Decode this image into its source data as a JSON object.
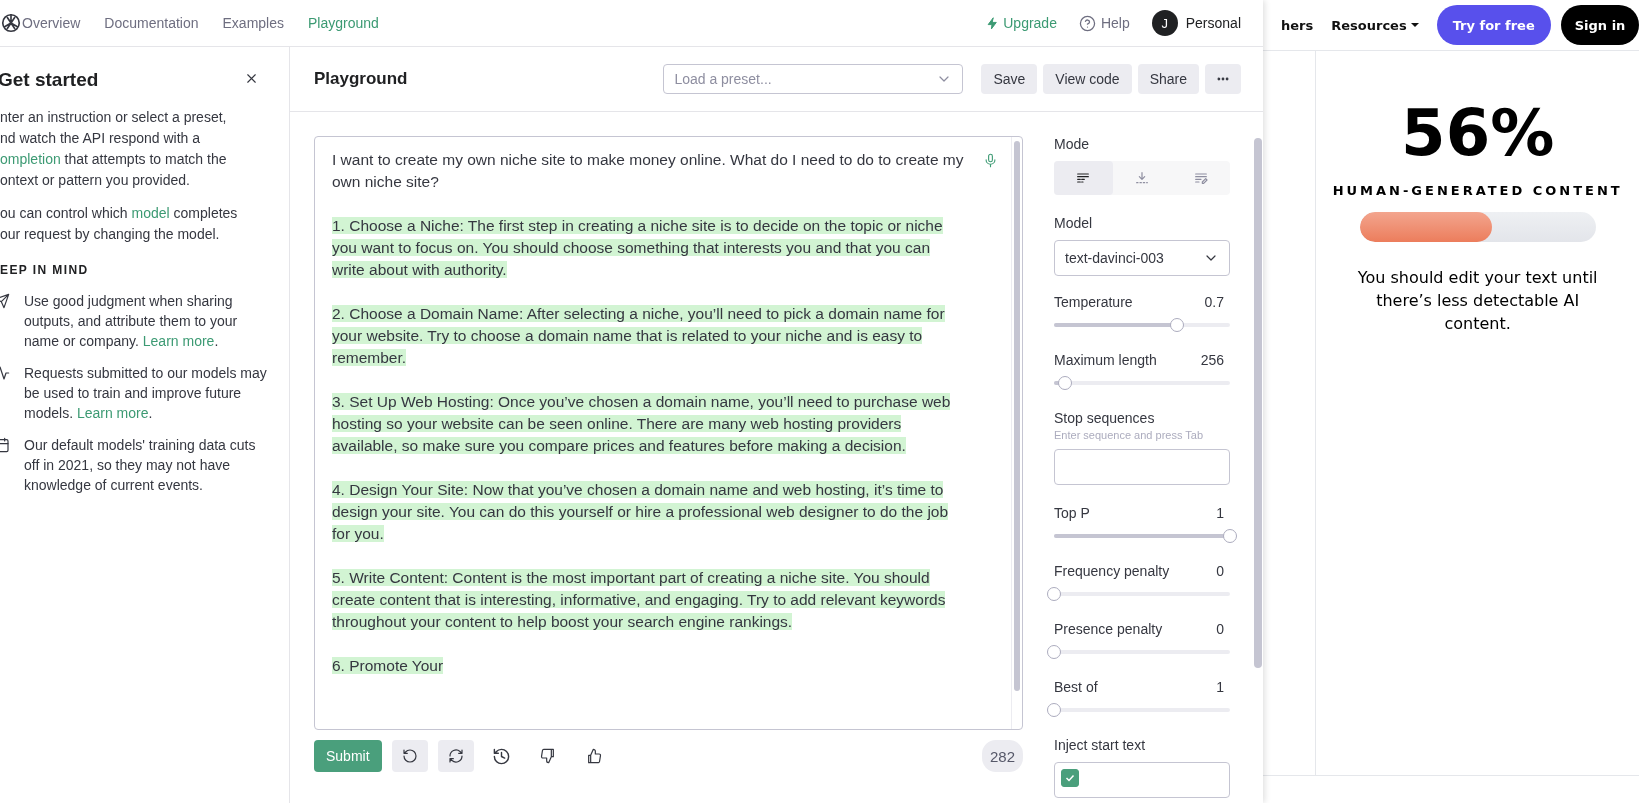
{
  "nav": {
    "tabs": [
      {
        "label": "Overview",
        "selected": false
      },
      {
        "label": "Documentation",
        "selected": false
      },
      {
        "label": "Examples",
        "selected": false
      },
      {
        "label": "Playground",
        "selected": true
      }
    ],
    "upgrade": "Upgrade",
    "help": "Help",
    "avatar": "J",
    "account": "Personal"
  },
  "sidebar": {
    "title": "Get started",
    "paragraphs": [
      [
        [
          {
            "text": "nter an instruction or select a preset,",
            "kind": "text"
          }
        ],
        [
          {
            "text": "nd watch the API respond with a",
            "kind": "text"
          }
        ],
        [
          {
            "text": "ompletion",
            "kind": "link"
          },
          {
            "text": " that attempts to match the",
            "kind": "text"
          }
        ],
        [
          {
            "text": "ontext or pattern you provided.",
            "kind": "text"
          }
        ]
      ],
      [
        [
          {
            "text": "ou can control which ",
            "kind": "text"
          },
          {
            "text": "model",
            "kind": "link"
          },
          {
            "text": " completes",
            "kind": "text"
          }
        ],
        [
          {
            "text": "our request by changing the model.",
            "kind": "text"
          }
        ]
      ]
    ],
    "heading": "EEP IN MIND",
    "items": [
      [
        {
          "text": "Use good judgment when sharing outputs, and attribute them to your name or company. ",
          "kind": "text"
        },
        {
          "text": "Learn more",
          "kind": "link"
        },
        {
          "text": ".",
          "kind": "text"
        }
      ],
      [
        {
          "text": "Requests submitted to our models may be used to train and improve future models. ",
          "kind": "text"
        },
        {
          "text": "Learn more",
          "kind": "link"
        },
        {
          "text": ".",
          "kind": "text"
        }
      ],
      [
        {
          "text": "Our default models' training data cuts off in 2021, so they may not have knowledge of current events.",
          "kind": "text"
        }
      ]
    ]
  },
  "header": {
    "title": "Playground",
    "preset_placeholder": "Load a preset...",
    "buttons": [
      "Save",
      "View code",
      "Share"
    ]
  },
  "editor": {
    "paragraphs": [
      {
        "kind": "prompt",
        "text": "I want to create my own niche site to make money online. What do I need to do to create my own niche site?"
      },
      {
        "kind": "completion",
        "text": "1. Choose a Niche: The first step in creating a niche site is to decide on the topic or niche you want to focus on. You should choose something that interests you and that you can write about with authority."
      },
      {
        "kind": "completion",
        "text": "2. Choose a Domain Name: After selecting a niche, you’ll need to pick a domain name for your website. Try to choose a domain name that is related to your niche and is easy to remember."
      },
      {
        "kind": "completion",
        "text": "3. Set Up Web Hosting: Once you’ve chosen a domain name, you’ll need to purchase web hosting so your website can be seen online. There are many web hosting providers available, so make sure you compare prices and features before making a decision."
      },
      {
        "kind": "completion",
        "text": "4. Design Your Site: Now that you’ve chosen a domain name and web hosting, it’s time to design your site. You can do this yourself or hire a professional web designer to do the job for you."
      },
      {
        "kind": "completion",
        "text": "5. Write Content: Content is the most important part of creating a niche site. You should create content that is interesting, informative, and engaging. Try to add relevant keywords throughout your content to help boost your search engine rankings."
      },
      {
        "kind": "completion",
        "text": "6. Promote Your"
      }
    ],
    "submit": "Submit",
    "token_count": "282"
  },
  "settings": {
    "mode_label": "Mode",
    "modes": [
      {
        "selected": true
      },
      {
        "selected": false
      },
      {
        "selected": false
      }
    ],
    "model_label": "Model",
    "model": "text-davinci-003",
    "controls": [
      {
        "kind": "slider",
        "label": "Temperature",
        "reading": "0.7",
        "level": 0.7
      },
      {
        "kind": "slider",
        "label": "Maximum length",
        "reading": "256",
        "level": 0.06
      },
      {
        "kind": "field",
        "label": "Stop sequences",
        "hint": "Enter sequence and press Tab"
      },
      {
        "kind": "slider",
        "label": "Top P",
        "reading": "1",
        "level": 1
      },
      {
        "kind": "slider",
        "label": "Frequency penalty",
        "reading": "0",
        "level": 0
      },
      {
        "kind": "slider",
        "label": "Presence penalty",
        "reading": "0",
        "level": 0
      },
      {
        "kind": "slider",
        "label": "Best of",
        "reading": "1",
        "level": 0
      },
      {
        "kind": "checkbox",
        "label": "Inject start text",
        "checked": true
      }
    ]
  },
  "website": {
    "nav_link": "hers",
    "resources": "Resources",
    "try_button": "Try for free",
    "signin_button": "Sign in",
    "score": "56%",
    "score_label": "HUMAN-GENERATED CONTENT",
    "level": 0.56,
    "message": "You should edit your text until there’s less detectable AI content."
  }
}
